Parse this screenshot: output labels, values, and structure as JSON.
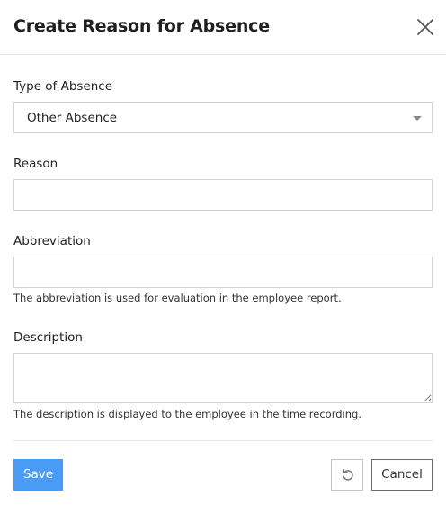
{
  "dialog": {
    "title": "Create Reason for Absence"
  },
  "form": {
    "type_of_absence": {
      "label": "Type of Absence",
      "value": "Other Absence"
    },
    "reason": {
      "label": "Reason",
      "value": ""
    },
    "abbreviation": {
      "label": "Abbreviation",
      "value": "",
      "help": "The abbreviation is used for evaluation in the employee report."
    },
    "description": {
      "label": "Description",
      "value": "",
      "help": "The description is displayed to the employee in the time recording."
    }
  },
  "footer": {
    "save_label": "Save",
    "cancel_label": "Cancel"
  },
  "icons": {
    "close": "close-icon",
    "reset": "reset-icon",
    "caret": "chevron-down-icon"
  },
  "colors": {
    "primary": "#4a9bf5",
    "border": "#cfd4d9",
    "text": "#222222"
  }
}
